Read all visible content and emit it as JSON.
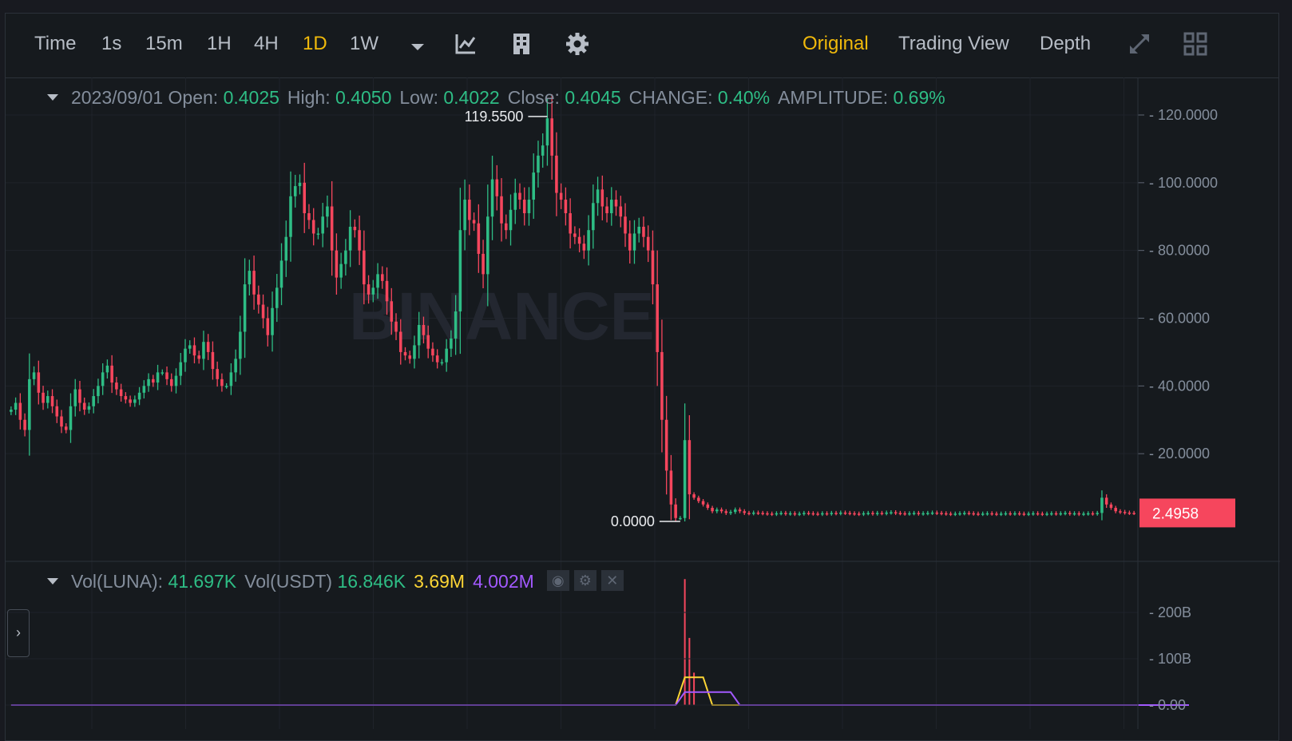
{
  "toolbar": {
    "intervals": [
      "Time",
      "1s",
      "15m",
      "1H",
      "4H",
      "1D",
      "1W"
    ],
    "active_interval": "1D",
    "views": [
      "Original",
      "Trading View",
      "Depth"
    ],
    "active_view": "Original",
    "icons": [
      "dropdown-caret-icon",
      "indicator-icon",
      "depth-chart-icon",
      "settings-icon",
      "expand-icon",
      "layout-grid-icon"
    ]
  },
  "ohlc": {
    "date": "2023/09/01",
    "open_label": "Open:",
    "open": "0.4025",
    "high_label": "High:",
    "high": "0.4050",
    "low_label": "Low:",
    "low": "0.4022",
    "close_label": "Close:",
    "close": "0.4045",
    "change_label": "CHANGE:",
    "change": "0.40%",
    "amplitude_label": "AMPLITUDE:",
    "amplitude": "0.69%"
  },
  "volume": {
    "luna_label": "Vol(LUNA):",
    "luna": "41.697K",
    "usdt_label": "Vol(USDT)",
    "usdt": "16.846K",
    "ma1": "3.69M",
    "ma2": "4.002M"
  },
  "watermark": "BINANCE",
  "colors": {
    "up": "#2ebd85",
    "down": "#f6465d",
    "accent": "#f0b90b",
    "ma1": "#fcd535",
    "ma2": "#a259ff"
  },
  "chart_data": {
    "type": "candlestick",
    "y_ticks": [
      "120.0000",
      "100.0000",
      "80.0000",
      "60.0000",
      "40.0000",
      "20.0000"
    ],
    "ylim": [
      -4,
      125
    ],
    "max_label": "119.5500",
    "min_label": "0.0000",
    "current_price": "2.4958",
    "vol_ticks": [
      "200B",
      "100B",
      "0.00"
    ],
    "vol_ylim": [
      0,
      290
    ],
    "closes": [
      33,
      35,
      30,
      27,
      42,
      44,
      38,
      35,
      37,
      34,
      31,
      28,
      27,
      34,
      39,
      35,
      33,
      34,
      37,
      40,
      44,
      46,
      41,
      39,
      37,
      36,
      35,
      36,
      38,
      40,
      42,
      41,
      44,
      44,
      42,
      40,
      43,
      47,
      51,
      52,
      49,
      48,
      53,
      50,
      45,
      42,
      40,
      40,
      44,
      48,
      56,
      70,
      74,
      67,
      64,
      60,
      55,
      63,
      69,
      77,
      84,
      96,
      99,
      100,
      91,
      89,
      85,
      85,
      90,
      93,
      80,
      72,
      76,
      80,
      87,
      86,
      80,
      70,
      67,
      69,
      73,
      71,
      65,
      59,
      56,
      50,
      49,
      48,
      52,
      58,
      55,
      51,
      49,
      47,
      47,
      51,
      54,
      62,
      86,
      95,
      89,
      88,
      79,
      73,
      90,
      101,
      96,
      88,
      86,
      92,
      97,
      95,
      91,
      95,
      103,
      108,
      111,
      119,
      108,
      97,
      95,
      91,
      85,
      84,
      82,
      80,
      86,
      94,
      98,
      93,
      91,
      95,
      93,
      90,
      85,
      80,
      85,
      87,
      84,
      80,
      70,
      50,
      30,
      15,
      5,
      1,
      1,
      24,
      8,
      7,
      6,
      5,
      4,
      3,
      3.5,
      3,
      2.5,
      2.8,
      3.5,
      3,
      2.5,
      2.4,
      2.6,
      2.5,
      2.4,
      2.3,
      2.2,
      2.4,
      2.5,
      2.3,
      2.4,
      2.2,
      2.3,
      2.5,
      2.4,
      2.3,
      2.2,
      2.4,
      2.3,
      2.5,
      2.4,
      2.6,
      2.5,
      2.4,
      2.3,
      2.2,
      2.4,
      2.5,
      2.3,
      2.5,
      2.4,
      2.6,
      2.7,
      2.5,
      2.4,
      2.3,
      2.4,
      2.5,
      2.3,
      2.4,
      2.5,
      2.6,
      2.5,
      2.4,
      2.3,
      2.2,
      2.3,
      2.4,
      2.5,
      2.4,
      2.3,
      2.2,
      2.3,
      2.4,
      2.3,
      2.2,
      2.3,
      2.4,
      2.3,
      2.4,
      2.3,
      2.2,
      2.3,
      2.4,
      2.3,
      2.2,
      2.3,
      2.4,
      2.3,
      2.4,
      2.5,
      2.3,
      2.4,
      2.2,
      2.3,
      2.4,
      2.3,
      2.5,
      7,
      5,
      4,
      3,
      2.8,
      2.6,
      2.5,
      2.4958
    ],
    "vol_spikes": [
      {
        "index": 147,
        "value": 272
      },
      {
        "index": 148,
        "value": 145
      },
      {
        "index": 149,
        "value": 70
      }
    ],
    "ma1_line": [
      {
        "i": 0,
        "v": 0
      },
      {
        "i": 145,
        "v": 0
      },
      {
        "i": 147,
        "v": 60
      },
      {
        "i": 151,
        "v": 60
      },
      {
        "i": 153,
        "v": 0
      },
      {
        "i": 257,
        "v": 0
      }
    ],
    "ma2_line": [
      {
        "i": 0,
        "v": 0
      },
      {
        "i": 145,
        "v": 0
      },
      {
        "i": 147,
        "v": 28
      },
      {
        "i": 157,
        "v": 28
      },
      {
        "i": 159,
        "v": 0
      },
      {
        "i": 257,
        "v": 0
      }
    ]
  }
}
